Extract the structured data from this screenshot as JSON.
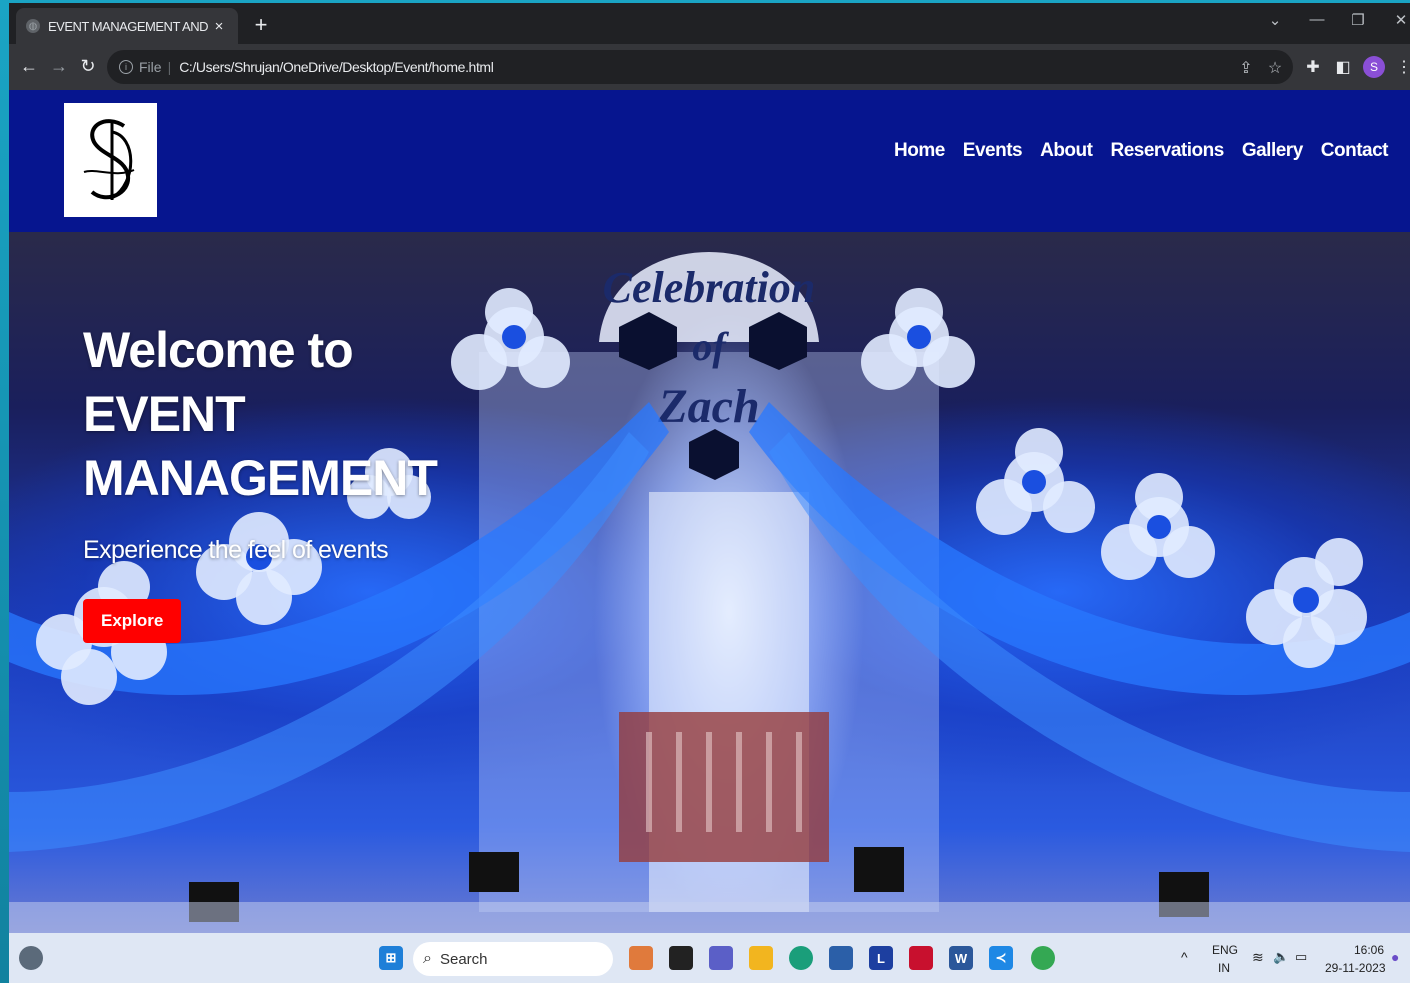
{
  "browser": {
    "tab_title": "EVENT MANAGEMENT AND TIC",
    "tab_close": "×",
    "new_tab": "+",
    "scheme": "File",
    "separator": "|",
    "url": "C:/Users/Shrujan/OneDrive/Desktop/Event/home.html",
    "profile_initial": "S"
  },
  "site": {
    "nav": [
      "Home",
      "Events",
      "About",
      "Reservations",
      "Gallery",
      "Contact"
    ],
    "hero_title": "Welcome to EVENT MANAGEMENT",
    "hero_subtitle": "Experience the feel of events",
    "explore_label": "Explore",
    "backdrop_text_1": "Celebration",
    "backdrop_text_2": "of",
    "backdrop_text_3": "Zach"
  },
  "taskbar": {
    "search_label": "Search",
    "lang_1": "ENG",
    "lang_2": "IN",
    "time": "16:06",
    "date": "29-11-2023"
  },
  "colors": {
    "header_bg": "#06158f",
    "explore_bg": "#ff0000",
    "avatar_bg": "#8a4fd6"
  }
}
